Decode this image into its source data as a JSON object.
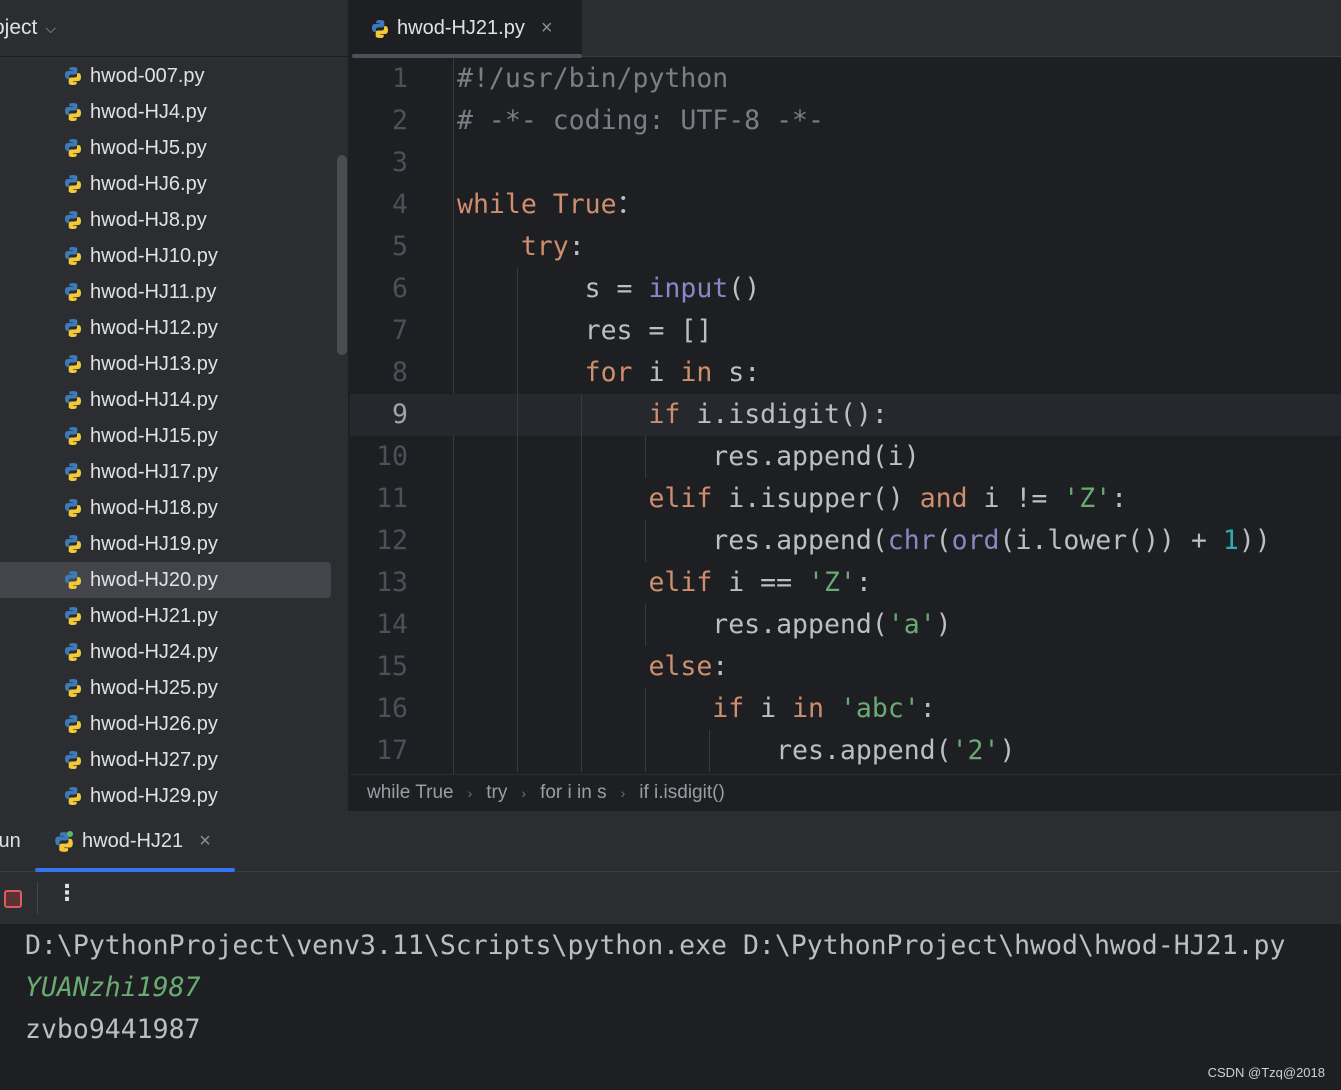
{
  "sidebar": {
    "title": "Project",
    "items": [
      "hwod-007.py",
      "hwod-HJ4.py",
      "hwod-HJ5.py",
      "hwod-HJ6.py",
      "hwod-HJ8.py",
      "hwod-HJ10.py",
      "hwod-HJ11.py",
      "hwod-HJ12.py",
      "hwod-HJ13.py",
      "hwod-HJ14.py",
      "hwod-HJ15.py",
      "hwod-HJ17.py",
      "hwod-HJ18.py",
      "hwod-HJ19.py",
      "hwod-HJ20.py",
      "hwod-HJ21.py",
      "hwod-HJ24.py",
      "hwod-HJ25.py",
      "hwod-HJ26.py",
      "hwod-HJ27.py",
      "hwod-HJ29.py"
    ],
    "selected": "hwod-HJ20.py"
  },
  "editor": {
    "tab": "hwod-HJ21.py",
    "current_line": 9,
    "lines": [
      [
        [
          "cm",
          "#!/usr/bin/python"
        ]
      ],
      [
        [
          "cm",
          "# -*- coding: UTF-8 -*-"
        ]
      ],
      [],
      [
        [
          "kw",
          "while "
        ],
        [
          "kw",
          "True"
        ],
        [
          "",
          "："
        ]
      ],
      [
        [
          "",
          "    "
        ],
        [
          "kw",
          "try"
        ],
        [
          "",
          ":"
        ]
      ],
      [
        [
          "",
          "        s = "
        ],
        [
          "bi",
          "input"
        ],
        [
          "",
          "()"
        ]
      ],
      [
        [
          "",
          "        res = []"
        ]
      ],
      [
        [
          "",
          "        "
        ],
        [
          "kw",
          "for "
        ],
        [
          "",
          "i "
        ],
        [
          "kw",
          "in "
        ],
        [
          "",
          "s:"
        ]
      ],
      [
        [
          "",
          "            "
        ],
        [
          "kw",
          "if "
        ],
        [
          "",
          "i.isdigit():"
        ]
      ],
      [
        [
          "",
          "                res.append(i)"
        ]
      ],
      [
        [
          "",
          "            "
        ],
        [
          "kw",
          "elif "
        ],
        [
          "",
          "i.isupper() "
        ],
        [
          "kw",
          "and "
        ],
        [
          "",
          "i != "
        ],
        [
          "str",
          "'Z'"
        ],
        [
          "",
          ":"
        ]
      ],
      [
        [
          "",
          "                res.append("
        ],
        [
          "bi",
          "chr"
        ],
        [
          "",
          "("
        ],
        [
          "bi",
          "ord"
        ],
        [
          "",
          "(i.lower()) + "
        ],
        [
          "num",
          "1"
        ],
        [
          "",
          "))"
        ]
      ],
      [
        [
          "",
          "            "
        ],
        [
          "kw",
          "elif "
        ],
        [
          "",
          "i == "
        ],
        [
          "str",
          "'Z'"
        ],
        [
          "",
          ":"
        ]
      ],
      [
        [
          "",
          "                res.append("
        ],
        [
          "str",
          "'a'"
        ],
        [
          "",
          ")"
        ]
      ],
      [
        [
          "",
          "            "
        ],
        [
          "kw",
          "else"
        ],
        [
          "",
          ":"
        ]
      ],
      [
        [
          "",
          "                "
        ],
        [
          "kw",
          "if "
        ],
        [
          "",
          "i "
        ],
        [
          "kw",
          "in "
        ],
        [
          "str",
          "'abc'"
        ],
        [
          "",
          ":"
        ]
      ],
      [
        [
          "",
          "                    res.append("
        ],
        [
          "str",
          "'2'"
        ],
        [
          "",
          ")"
        ]
      ]
    ]
  },
  "breadcrumbs": [
    "while True",
    "try",
    "for i in s",
    "if i.isdigit()"
  ],
  "run": {
    "panel_label": "Run",
    "tab": "hwod-HJ21",
    "console": [
      {
        "type": "cmd",
        "text": "D:\\PythonProject\\venv3.11\\Scripts\\python.exe D:\\PythonProject\\hwod\\hwod-HJ21.py"
      },
      {
        "type": "in",
        "text": "YUANzhi1987"
      },
      {
        "type": "out",
        "text": "zvbo9441987"
      }
    ]
  },
  "watermark": "CSDN @Tzq@2018"
}
